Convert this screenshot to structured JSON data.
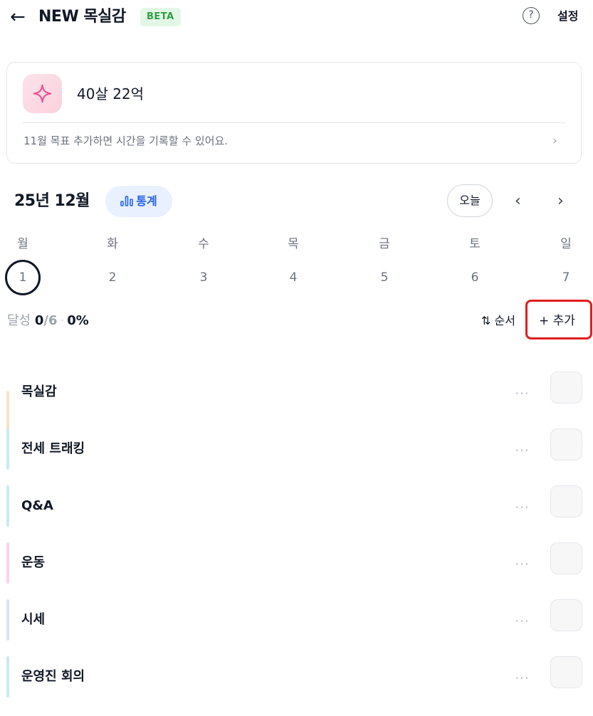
{
  "header": {
    "back_icon": "←",
    "title": "NEW 목실감",
    "badge": "BETA",
    "help_icon": "?",
    "settings_label": "설정"
  },
  "goal_card": {
    "icon": "sparkle-icon",
    "name": "40살 22억",
    "hint": "11월 목표  추가하면 시간을 기록할 수 있어요.",
    "chevron": "›"
  },
  "calendar": {
    "month_label": "25년 12월",
    "stats_label": "통계",
    "today_label": "오늘",
    "prev_icon": "‹",
    "next_icon": "›",
    "weekdays": [
      "월",
      "화",
      "수",
      "목",
      "금",
      "토",
      "일"
    ],
    "dates": [
      "1",
      "2",
      "3",
      "4",
      "5",
      "6",
      "7"
    ],
    "selected_index": 0
  },
  "summary": {
    "label": "달성",
    "count": "0",
    "total": "/6",
    "separator": "·",
    "percent": "0%",
    "sort_label": "⇅ 순서",
    "add_label": "+ 추가"
  },
  "tasks": [
    {
      "name": "목실감",
      "more": "···",
      "color": "#fbe3bf"
    },
    {
      "name": "전세 트래킹",
      "more": "···",
      "color": "#c7ecf3"
    },
    {
      "name": "Q&A",
      "more": "···",
      "color": "#c7ecf3"
    },
    {
      "name": "운동",
      "more": "···",
      "color": "#fcd3e7"
    },
    {
      "name": "시세",
      "more": "···",
      "color": "#d6e2f8"
    },
    {
      "name": "운영진 회의",
      "more": "···",
      "color": "#c7ecf3"
    }
  ]
}
